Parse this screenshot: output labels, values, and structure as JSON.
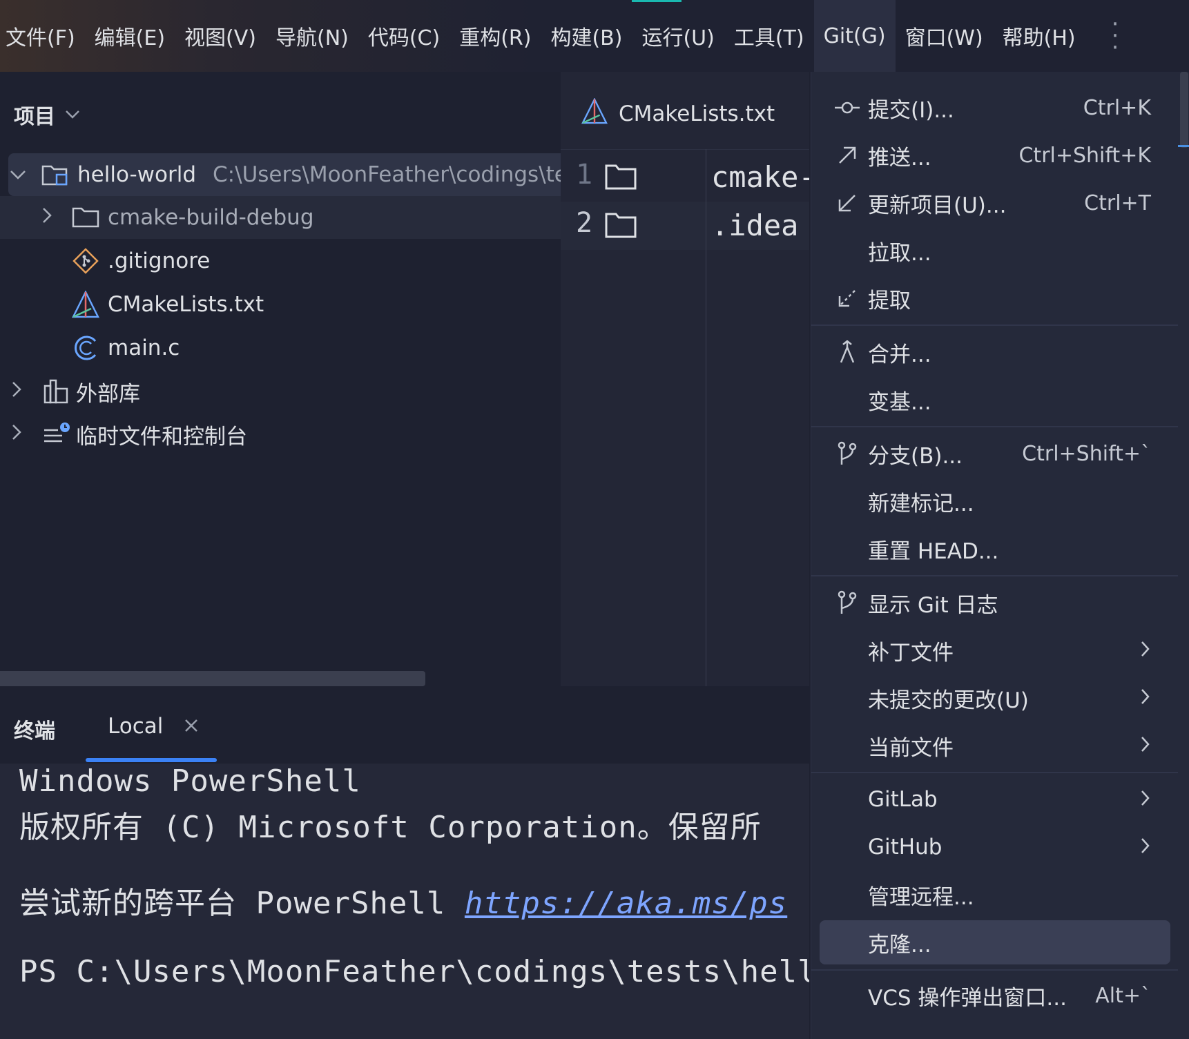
{
  "menubar": {
    "items": [
      "文件(F)",
      "编辑(E)",
      "视图(V)",
      "导航(N)",
      "代码(C)",
      "重构(R)",
      "构建(B)",
      "运行(U)",
      "工具(T)",
      "Git(G)",
      "窗口(W)",
      "帮助(H)"
    ],
    "active": "Git(G)",
    "more_icon": "more-vertical-icon"
  },
  "project": {
    "title": "项目",
    "tree": [
      {
        "label": "hello-world",
        "path": "C:\\Users\\MoonFeather\\codings\\te",
        "icon": "project-folder-icon",
        "expanded": true
      },
      {
        "label": "cmake-build-debug",
        "icon": "folder-icon",
        "expanded": false
      },
      {
        "label": ".gitignore",
        "icon": "gitignore-icon"
      },
      {
        "label": "CMakeLists.txt",
        "icon": "cmake-icon"
      },
      {
        "label": "main.c",
        "icon": "c-file-icon"
      },
      {
        "label": "外部库",
        "icon": "library-icon",
        "expanded": false
      },
      {
        "label": "临时文件和控制台",
        "icon": "scratch-icon",
        "expanded": false
      }
    ]
  },
  "editor": {
    "tab_label": "CMakeLists.txt",
    "lines": [
      {
        "num": "1",
        "text": "cmake-"
      },
      {
        "num": "2",
        "text": ".idea"
      }
    ]
  },
  "terminal": {
    "title": "终端",
    "tab_label": "Local",
    "lines": {
      "l1": "Windows PowerShell",
      "l2": "版权所有 (C) Microsoft Corporation。保留所",
      "l3_text": "尝试新的跨平台 PowerShell ",
      "l3_link": "https://aka.ms/ps",
      "l4": "PS C:\\Users\\MoonFeather\\codings\\tests\\hell"
    }
  },
  "git_menu": {
    "items": [
      {
        "label": "提交(I)...",
        "shortcut": "Ctrl+K",
        "icon": "commit-icon"
      },
      {
        "label": "推送...",
        "shortcut": "Ctrl+Shift+K",
        "icon": "push-icon"
      },
      {
        "label": "更新项目(U)...",
        "shortcut": "Ctrl+T",
        "icon": "update-icon"
      },
      {
        "label": "拉取...",
        "shortcut": ""
      },
      {
        "label": "提取",
        "shortcut": "",
        "icon": "fetch-icon"
      },
      {
        "label": "合并...",
        "shortcut": "",
        "icon": "merge-icon"
      },
      {
        "label": "变基...",
        "shortcut": ""
      },
      {
        "label": "分支(B)...",
        "shortcut": "Ctrl+Shift+`",
        "icon": "branch-icon"
      },
      {
        "label": "新建标记...",
        "shortcut": ""
      },
      {
        "label": "重置 HEAD...",
        "shortcut": ""
      },
      {
        "label": "显示 Git 日志",
        "shortcut": "",
        "icon": "git-log-icon"
      },
      {
        "label": "补丁文件",
        "submenu": true
      },
      {
        "label": "未提交的更改(U)",
        "submenu": true
      },
      {
        "label": "当前文件",
        "submenu": true
      },
      {
        "label": "GitLab",
        "submenu": true
      },
      {
        "label": "GitHub",
        "submenu": true
      },
      {
        "label": "管理远程...",
        "shortcut": ""
      },
      {
        "label": "克隆...",
        "shortcut": "",
        "highlighted": true
      },
      {
        "label": "VCS 操作弹出窗口...",
        "shortcut": "Alt+`"
      }
    ]
  },
  "colors": {
    "background": "#1e2130",
    "menu_bg": "#25293a",
    "highlight": "#3a3f55",
    "link": "#7ea5ff",
    "accent": "#3b82f6"
  }
}
